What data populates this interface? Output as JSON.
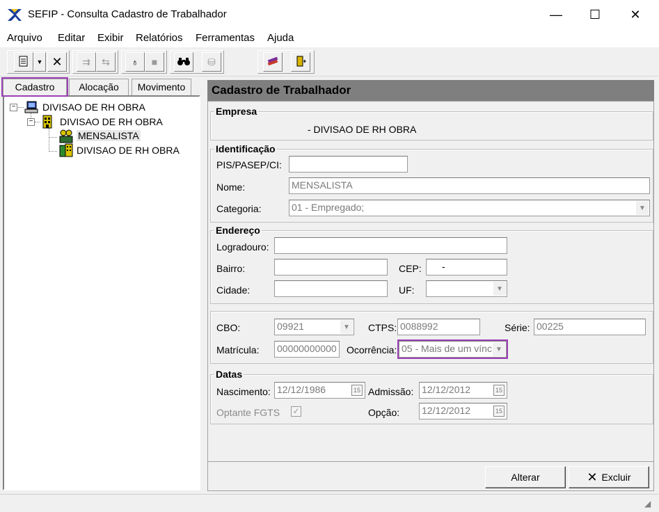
{
  "window": {
    "title": "SEFIP - Consulta Cadastro de Trabalhador",
    "minimize": "—",
    "maximize": "☐",
    "close": "✕"
  },
  "menu": [
    "Arquivo",
    "Editar",
    "Exibir",
    "Relatórios",
    "Ferramentas",
    "Ajuda"
  ],
  "tabs": [
    "Cadastro",
    "Alocação",
    "Movimento"
  ],
  "tree": {
    "root": "DIVISAO DE RH OBRA",
    "child": "DIVISAO DE RH OBRA",
    "leaf1": "MENSALISTA",
    "leaf2": "DIVISAO DE RH OBRA"
  },
  "panel": {
    "header": "Cadastro de Trabalhador",
    "empresa": {
      "title": "Empresa",
      "value": "-  DIVISAO DE RH OBRA"
    },
    "identificacao": {
      "title": "Identificação",
      "pis_label": "PIS/PASEP/CI:",
      "pis_value": "",
      "nome_label": "Nome:",
      "nome_value": "MENSALISTA",
      "categoria_label": "Categoria:",
      "categoria_value": "01 - Empregado;"
    },
    "endereco": {
      "title": "Endereço",
      "logradouro_label": "Logradouro:",
      "logradouro_value": "",
      "bairro_label": "Bairro:",
      "bairro_value": "",
      "cep_label": "CEP:",
      "cep_value": "-",
      "cidade_label": "Cidade:",
      "cidade_value": "",
      "uf_label": "UF:",
      "uf_value": ""
    },
    "outros": {
      "cbo_label": "CBO:",
      "cbo_value": "09921",
      "ctps_label": "CTPS:",
      "ctps_value": "0088992",
      "serie_label": "Série:",
      "serie_value": "00225",
      "matricula_label": "Matrícula:",
      "matricula_value": "00000000000",
      "ocorrencia_label": "Ocorrência:",
      "ocorrencia_value": "05 - Mais de um vínc"
    },
    "datas": {
      "title": "Datas",
      "nascimento_label": "Nascimento:",
      "nascimento_value": "12/12/1986",
      "admissao_label": "Admissão:",
      "admissao_value": "12/12/2012",
      "optante_label": "Optante FGTS",
      "opcao_label": "Opção:",
      "opcao_value": "12/12/2012",
      "cal_icon": "15"
    },
    "buttons": {
      "alterar": "Alterar",
      "excluir": "Excluir"
    }
  },
  "colors": {
    "highlight": "#9b3fb5",
    "header_bg": "#7f7f7f"
  }
}
